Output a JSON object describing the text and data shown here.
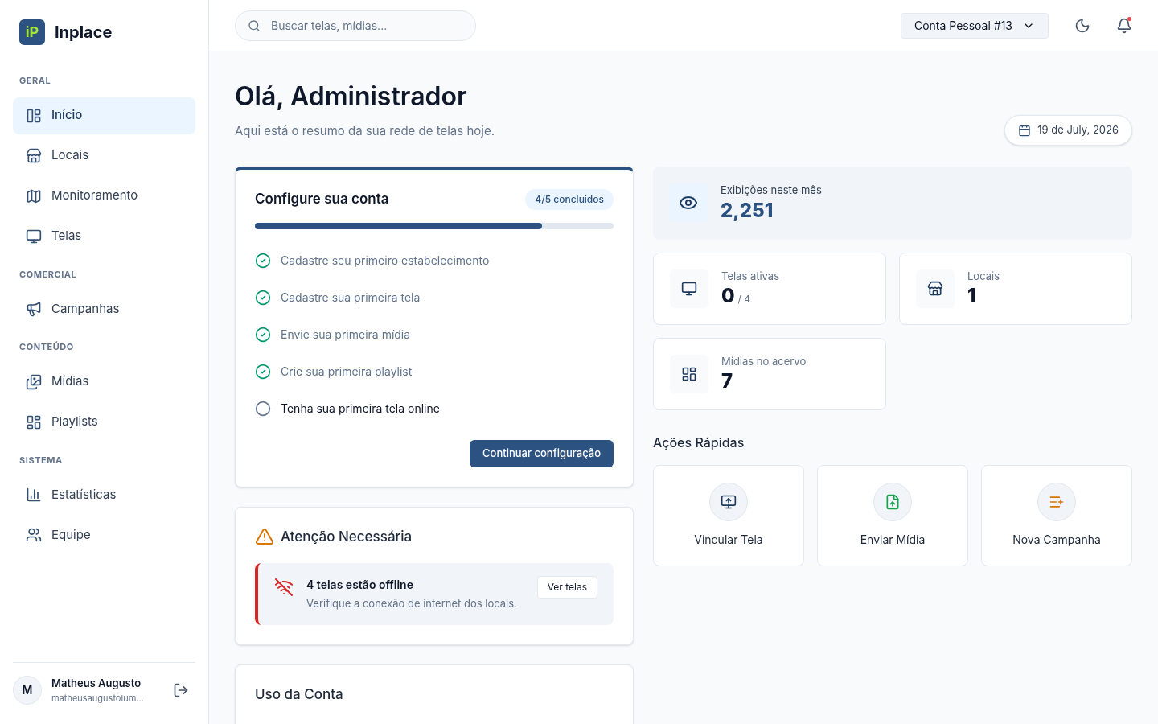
{
  "brand": {
    "logo": "iP",
    "name": "Inplace"
  },
  "sidebar": {
    "sections": [
      {
        "title": "GERAL",
        "items": [
          {
            "label": "Início",
            "selected": true
          },
          {
            "label": "Locais",
            "selected": false
          },
          {
            "label": "Monitoramento",
            "selected": false
          },
          {
            "label": "Telas",
            "selected": false
          }
        ]
      },
      {
        "title": "COMERCIAL",
        "items": [
          {
            "label": "Campanhas",
            "selected": false
          }
        ]
      },
      {
        "title": "CONTEÚDO",
        "items": [
          {
            "label": "Mídias",
            "selected": false
          },
          {
            "label": "Playlists",
            "selected": false
          }
        ]
      },
      {
        "title": "SISTEMA",
        "items": [
          {
            "label": "Estatísticas",
            "selected": false
          },
          {
            "label": "Equipe",
            "selected": false
          }
        ]
      }
    ],
    "user": {
      "initial": "M",
      "name": "Matheus Augusto",
      "email": "matheusaugustolum..."
    }
  },
  "topbar": {
    "search": {
      "placeholder": "Buscar telas, mídias..."
    },
    "account": "Conta Pessoal #13",
    "notification_dot": true
  },
  "greeting": {
    "title": "Olá, Administrador",
    "subtitle": "Aqui está o resumo da sua rede de telas hoje.",
    "date": "19 de July, 2026"
  },
  "setup": {
    "title": "Configure sua conta",
    "badge": "4/5 concluídos",
    "level": 0.8,
    "steps": [
      {
        "label": "Cadastre seu primeiro estabelecimento",
        "done": true
      },
      {
        "label": "Cadastre sua primeira tela",
        "done": true
      },
      {
        "label": "Envie sua primeira mídia",
        "done": true
      },
      {
        "label": "Crie sua primeira playlist",
        "done": true
      },
      {
        "label": "Tenha sua primeira tela online",
        "done": false
      }
    ],
    "button": "Continuar configuração"
  },
  "attention": {
    "title": "Atenção Necessária",
    "alert": {
      "title": "4 telas estão offline",
      "message": "Verifique a conexão de internet dos locais.",
      "button": "Ver telas"
    }
  },
  "usage": {
    "title": "Uso da Conta"
  },
  "highlight": {
    "label": "Exibições neste mês",
    "value": "2,251"
  },
  "stats": [
    {
      "label": "Telas ativas",
      "value": "0",
      "total": "/ 4"
    },
    {
      "label": "Locais",
      "value": "1"
    },
    {
      "label": "Mídias no acervo",
      "value": "7"
    }
  ],
  "quick_actions": {
    "title": "Ações Rápidas",
    "items": [
      {
        "label": "Vincular Tela",
        "color": "#1e3a5f"
      },
      {
        "label": "Enviar Mídia",
        "color": "#16a34a"
      },
      {
        "label": "Nova Campanha",
        "color": "#d97706"
      }
    ]
  }
}
